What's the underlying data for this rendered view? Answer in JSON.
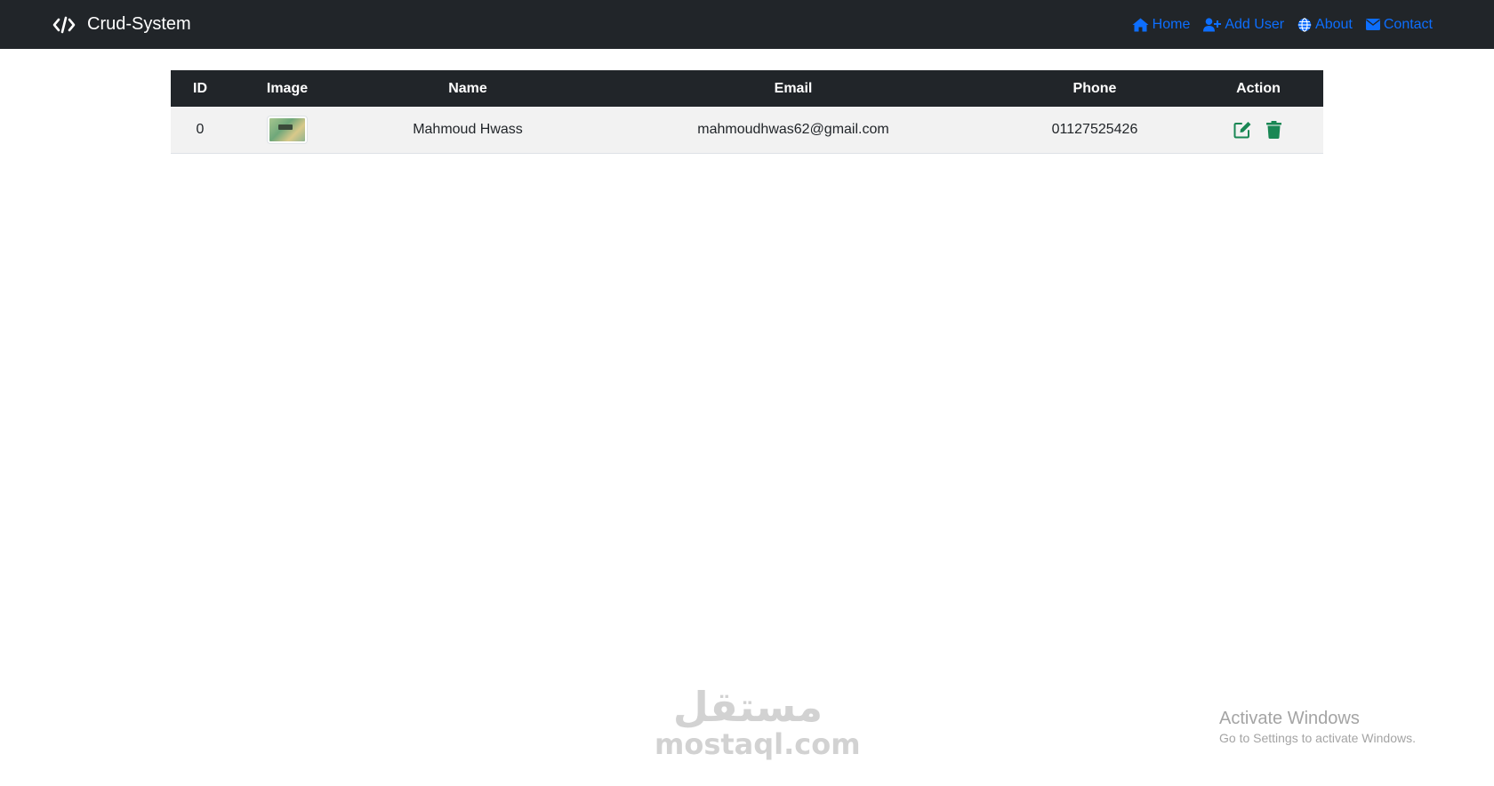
{
  "navbar": {
    "brand": "Crud-System",
    "brand_icon": "code-icon",
    "links": [
      {
        "label": "Home",
        "icon": "home-icon"
      },
      {
        "label": "Add User",
        "icon": "user-plus-icon"
      },
      {
        "label": "About",
        "icon": "globe-icon"
      },
      {
        "label": "Contact",
        "icon": "envelope-icon"
      }
    ],
    "link_color": "#0d6efd",
    "background": "#212529"
  },
  "table": {
    "headers": [
      "ID",
      "Image",
      "Name",
      "Email",
      "Phone",
      "Action"
    ],
    "rows": [
      {
        "id": "0",
        "image": "user-thumbnail",
        "name": "Mahmoud Hwass",
        "email": "mahmoudhwas62@gmail.com",
        "phone": "01127525426",
        "actions": [
          "edit-icon",
          "trash-icon"
        ]
      }
    ],
    "action_color": "#198754"
  },
  "watermark": {
    "arabic": "مستقل",
    "latin": "mostaql.com"
  },
  "windows_notice": {
    "title": "Activate Windows",
    "subtitle": "Go to Settings to activate Windows."
  }
}
